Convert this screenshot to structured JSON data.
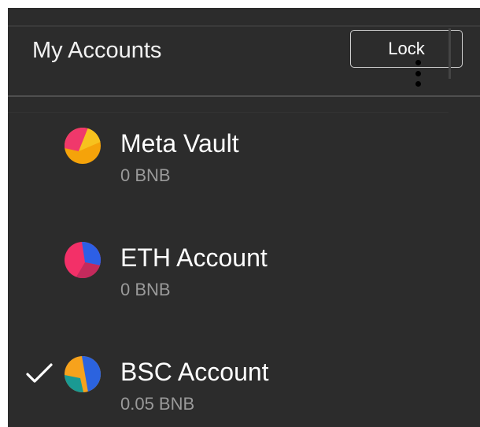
{
  "header": {
    "title": "My Accounts",
    "lock_label": "Lock"
  },
  "accounts": [
    {
      "name": "Meta Vault",
      "balance": "0 BNB",
      "selected": false,
      "avatar_icon": "jazzicon-avatar",
      "avatar_colors": [
        "#f5a30a",
        "#f0386b",
        "#f7c21e"
      ]
    },
    {
      "name": "ETH Account",
      "balance": "0 BNB",
      "selected": false,
      "avatar_icon": "jazzicon-avatar",
      "avatar_colors": [
        "#f33068",
        "#c42a5c",
        "#2d5fe6"
      ]
    },
    {
      "name": "BSC Account",
      "balance": "0.05 BNB",
      "selected": true,
      "avatar_icon": "jazzicon-avatar",
      "avatar_colors": [
        "#f7a21c",
        "#2b63df",
        "#1a9a93"
      ]
    }
  ],
  "colors": {
    "background": "#2c2c2c",
    "text": "#ffffff",
    "muted_text": "#9a9a9a",
    "divider": "#4f4f4f"
  }
}
